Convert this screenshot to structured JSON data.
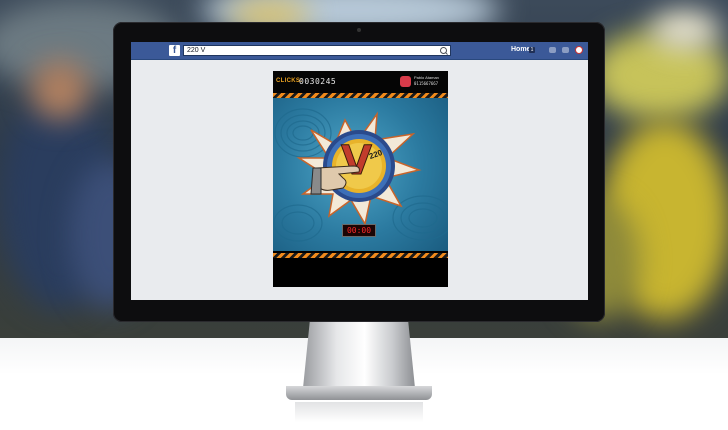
{
  "browser": {
    "search_value": "220 V",
    "logo_glyph": "f",
    "home_label": "Home",
    "home_badge": "1",
    "accent_color": "#3b5998"
  },
  "game": {
    "clicks_label": "CLICKS:",
    "clicks_value": "0030245",
    "profile_name": "Pablo Ataman",
    "profile_id": "0115667667",
    "timer": "00:00",
    "logo_letter": "V",
    "logo_number": "220",
    "hazard_colors": [
      "#f08a1c",
      "#1a1a1a"
    ]
  }
}
